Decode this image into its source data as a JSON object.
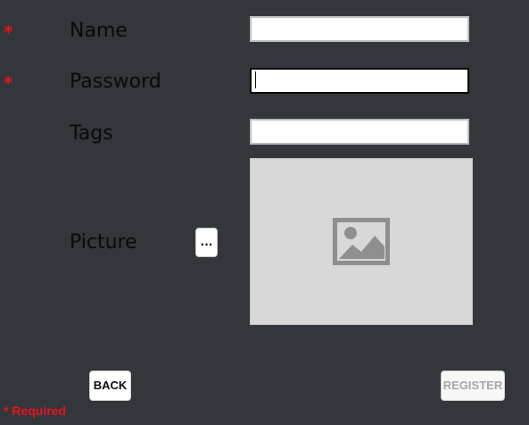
{
  "colors": {
    "background": "#33363b",
    "required_marker": "#e8131d",
    "label_text": "#0a0a0a",
    "field_background": "#ffffff",
    "picture_placeholder": "#d8d8d8",
    "register_disabled_text": "#a7a7a7"
  },
  "form": {
    "name": {
      "required_marker": "*",
      "label": "Name",
      "value": ""
    },
    "password": {
      "required_marker": "*",
      "label": "Password",
      "value": ""
    },
    "tags": {
      "label": "Tags",
      "value": ""
    },
    "picture": {
      "label": "Picture",
      "browse_label": "...",
      "placeholder_icon": "image-icon"
    }
  },
  "actions": {
    "back_label": "BACK",
    "register_label": "REGISTER",
    "register_enabled": false
  },
  "footer": {
    "required_note": "* Required"
  }
}
